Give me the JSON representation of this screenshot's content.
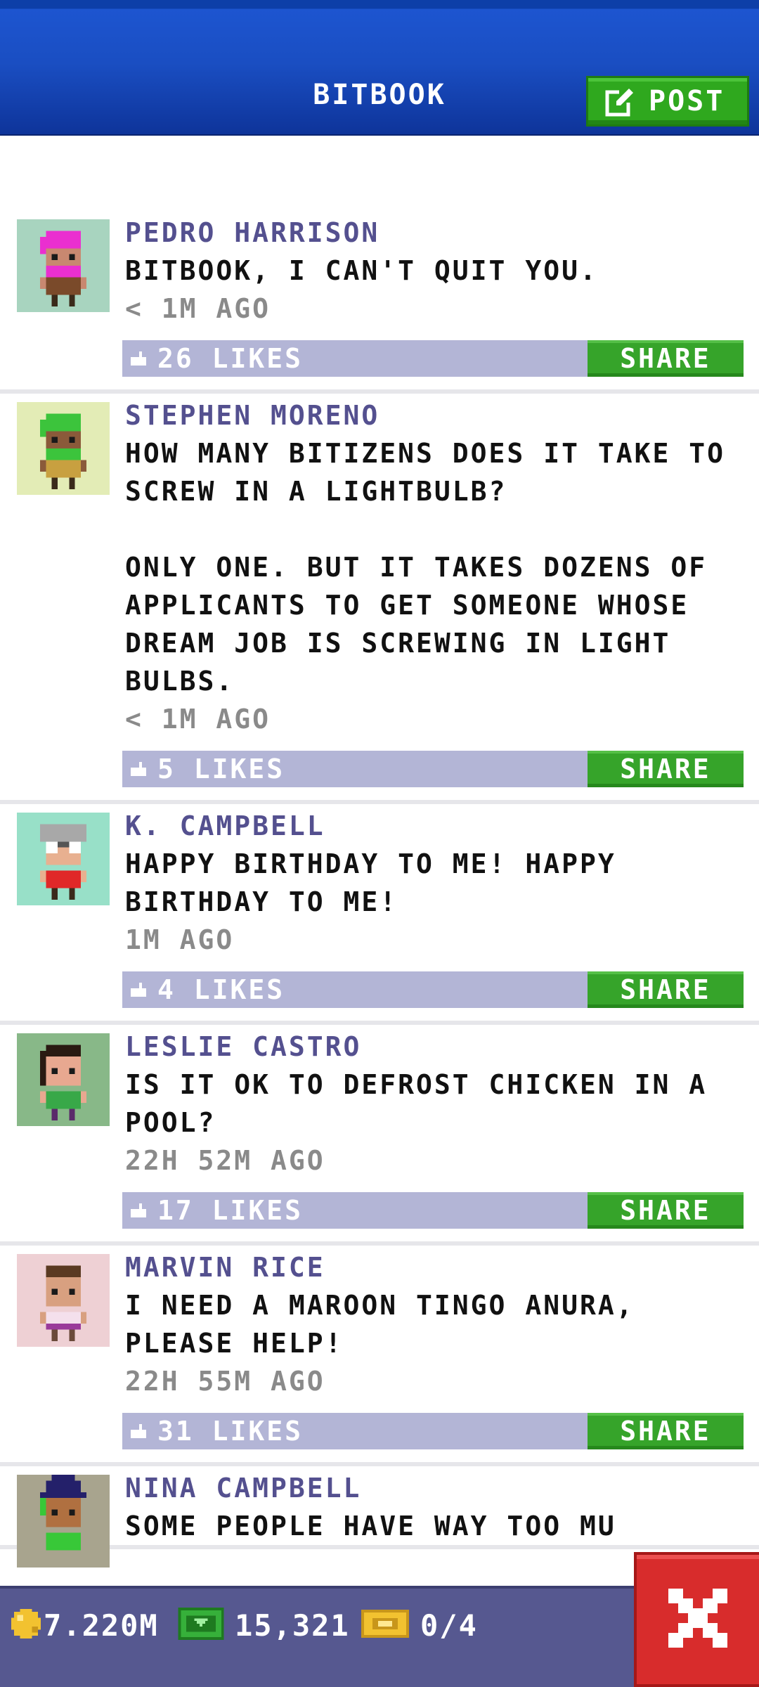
{
  "header": {
    "title": "BITBOOK",
    "post_label": "POST"
  },
  "posts": [
    {
      "author": "PEDRO HARRISON",
      "message": "BITBOOK, I CAN'T QUIT YOU.",
      "time": "< 1M AGO",
      "likes": "26 LIKES",
      "share_label": "SHARE",
      "avatar_bg": "#a8d4bf",
      "hair_color": "#ea2fd0"
    },
    {
      "author": "STEPHEN MORENO",
      "message": "HOW MANY BITIZENS DOES IT TAKE TO SCREW IN A LIGHTBULB?\n\nONLY ONE. BUT IT TAKES DOZENS OF APPLICANTS TO GET SOMEONE WHOSE DREAM JOB IS SCREWING IN LIGHT BULBS.",
      "time": "< 1M AGO",
      "likes": "5 LIKES",
      "share_label": "SHARE",
      "avatar_bg": "#e3ecb6",
      "hair_color": "#3cc43c"
    },
    {
      "author": "K. CAMPBELL",
      "message": "HAPPY BIRTHDAY TO ME! HAPPY BIRTHDAY TO ME!",
      "time": "1M AGO",
      "likes": "4 LIKES",
      "share_label": "SHARE",
      "avatar_bg": "#98e0c8",
      "hair_color": "#a8a8a8"
    },
    {
      "author": "LESLIE CASTRO",
      "message": "IS IT OK TO DEFROST CHICKEN IN A POOL?",
      "time": "22H 52M AGO",
      "likes": "17 LIKES",
      "share_label": "SHARE",
      "avatar_bg": "#88b888",
      "hair_color": "#2a1a12"
    },
    {
      "author": "MARVIN RICE",
      "message": "I NEED A MAROON TINGO ANURA, PLEASE HELP!",
      "time": "22H 55M AGO",
      "likes": "31 LIKES",
      "share_label": "SHARE",
      "avatar_bg": "#eed0d4",
      "hair_color": "#5a3a22"
    },
    {
      "author": "NINA CAMPBELL",
      "message": "SOME PEOPLE HAVE WAY TOO MU",
      "avatar_bg": "#a8a48e",
      "hair_color": "#24206a"
    }
  ],
  "bottom_bar": {
    "coins": "7.220M",
    "bux": "15,321",
    "tickets": "0/4"
  },
  "colors": {
    "header_blue": "#1a4ec2",
    "post_green": "#2fa81e",
    "author_purple": "#54508f",
    "like_bar": "#b3b5d6",
    "share_green": "#36a42a",
    "bottom_bar": "#565890",
    "close_red": "#d82c2c"
  },
  "icons": {
    "post": "edit-icon",
    "like": "thumbs-up-icon",
    "coin": "coin-icon",
    "bux": "bux-icon",
    "ticket": "ticket-icon",
    "close": "close-icon"
  }
}
